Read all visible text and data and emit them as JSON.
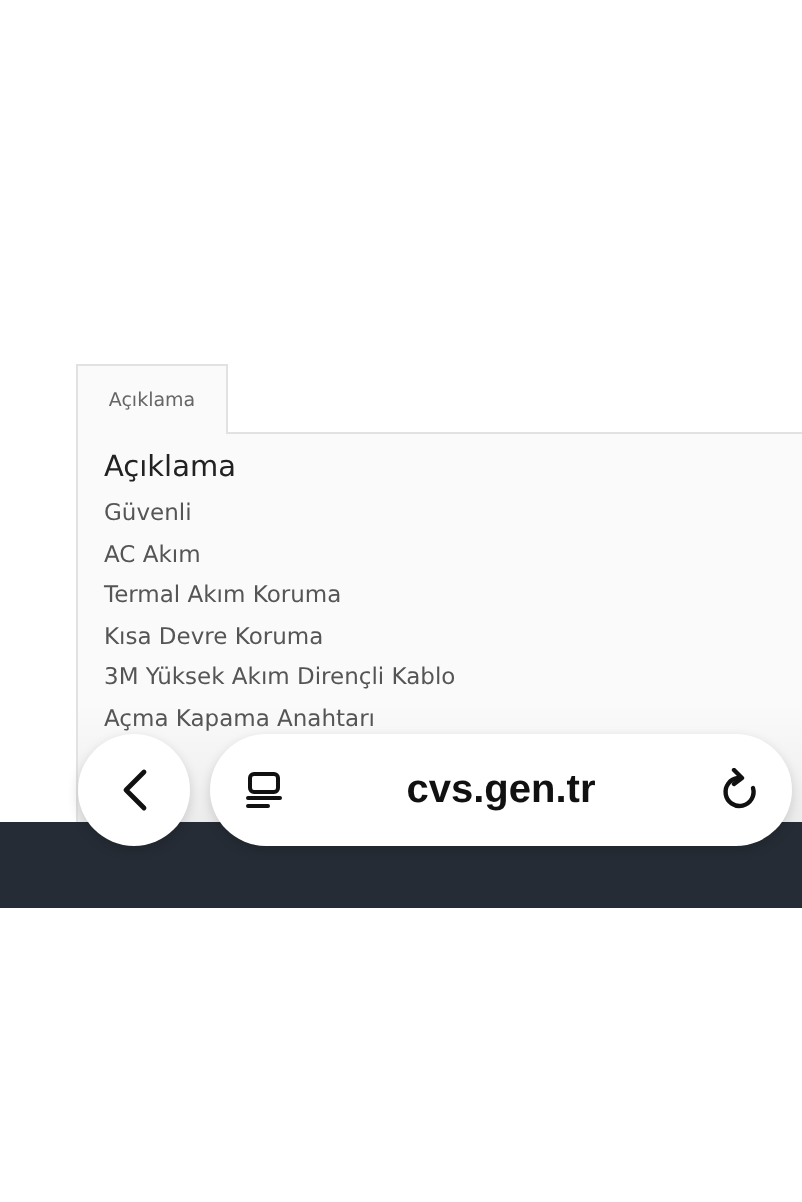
{
  "tabs": [
    {
      "label": "Açıklama",
      "selected": true
    }
  ],
  "panel": {
    "heading": "Açıklama",
    "items": [
      "Güvenli",
      "AC Akım",
      "Termal Akım Koruma",
      "Kısa Devre Koruma",
      "3M Yüksek Akım Dirençli Kablo",
      "Açma Kapama Anahtarı"
    ]
  },
  "browser_bar": {
    "url": "cvs.gen.tr"
  }
}
